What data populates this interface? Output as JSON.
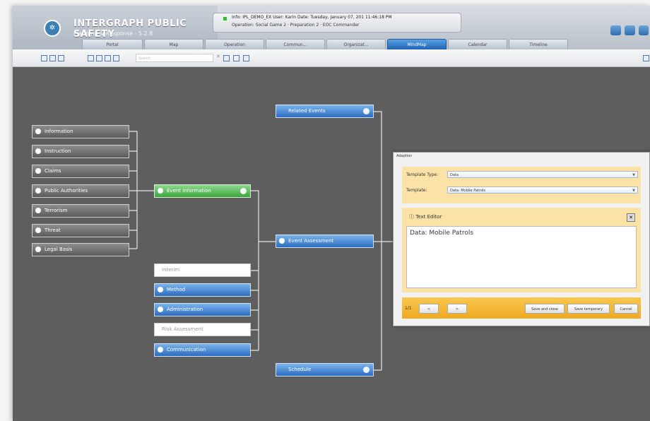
{
  "app": {
    "brand": "INTERGRAPH PUBLIC SAFETY",
    "subtitle": "Planning & Response · 5.2.8",
    "status_line1": "Info: IPL_DEMO_EX   User: Karin   Date: Tuesday, January 07, 201 11:46:18 PM",
    "status_line2": "Operation: Social Game 2 · Preparation 2 · EOC Commander"
  },
  "tabs": [
    {
      "label": "Portal",
      "active": false
    },
    {
      "label": "Map",
      "active": false
    },
    {
      "label": "Operation",
      "active": false
    },
    {
      "label": "Commun...",
      "active": false
    },
    {
      "label": "Organizat...",
      "active": false
    },
    {
      "label": "MindMap",
      "active": true
    },
    {
      "label": "Calendar",
      "active": false
    },
    {
      "label": "Timeline",
      "active": false
    }
  ],
  "toolbar": {
    "search_placeholder": "Search",
    "clear": "✕"
  },
  "mindmap": {
    "left_nodes": [
      "Information",
      "Instruction",
      "Claims",
      "Public Authorities",
      "Terrorism",
      "Threat",
      "Legal Basis"
    ],
    "center": "Event Information",
    "bottom_nodes": [
      {
        "label": "Interim",
        "style": "white"
      },
      {
        "label": "Method",
        "style": "blue"
      },
      {
        "label": "Administration",
        "style": "blue"
      },
      {
        "label": "Risk Assessment",
        "style": "white"
      },
      {
        "label": "Communication",
        "style": "blue"
      }
    ],
    "right_nodes": [
      "Related Events",
      "Event Assessment",
      "Schedule"
    ]
  },
  "panel": {
    "title": "Adaption",
    "template_type_label": "Template Type:",
    "template_type_value": "Data",
    "template_label": "Template:",
    "template_value": "Data: Mobile Patrols",
    "editor_title": "Text Editor",
    "editor_close": "✕",
    "editor_text": "Data: Mobile Patrols",
    "pager": "1/1",
    "prev": "<",
    "next": ">",
    "save_close": "Save and close",
    "save_temp": "Save temporary",
    "cancel": "Cancel"
  }
}
